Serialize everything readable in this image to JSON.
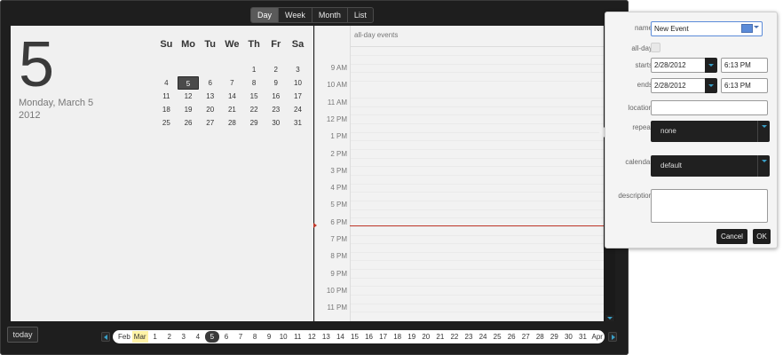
{
  "view_tabs": [
    "Day",
    "Week",
    "Month",
    "List"
  ],
  "active_view": "Day",
  "selected_day": {
    "day_number": "5",
    "day_name": "Monday, March 5",
    "year": "2012"
  },
  "mini_calendar": {
    "weekdays": [
      "Su",
      "Mo",
      "Tu",
      "We",
      "Th",
      "Fr",
      "Sa"
    ],
    "weeks": [
      [
        "",
        "",
        "",
        "",
        "1",
        "2",
        "3"
      ],
      [
        "4",
        "5",
        "6",
        "7",
        "8",
        "9",
        "10"
      ],
      [
        "11",
        "12",
        "13",
        "14",
        "15",
        "16",
        "17"
      ],
      [
        "18",
        "19",
        "20",
        "21",
        "22",
        "23",
        "24"
      ],
      [
        "25",
        "26",
        "27",
        "28",
        "29",
        "30",
        "31"
      ]
    ],
    "selected": "5"
  },
  "day_view": {
    "allday_label": "all-day events",
    "hours": [
      "9 AM",
      "10 AM",
      "11 AM",
      "12 PM",
      "1 PM",
      "2 PM",
      "3 PM",
      "4 PM",
      "5 PM",
      "6 PM",
      "7 PM",
      "8 PM",
      "9 PM",
      "10 PM",
      "11 PM"
    ]
  },
  "bottom_bar": {
    "today_label": "today",
    "prev_month": "Feb",
    "current_month": "Mar",
    "next_month": "Apr",
    "days": [
      "1",
      "2",
      "3",
      "4",
      "5",
      "6",
      "7",
      "8",
      "9",
      "10",
      "11",
      "12",
      "13",
      "14",
      "15",
      "16",
      "17",
      "18",
      "19",
      "20",
      "21",
      "22",
      "23",
      "24",
      "25",
      "26",
      "27",
      "28",
      "29",
      "30",
      "31"
    ],
    "selected_day": "5"
  },
  "event_form": {
    "name_label": "name",
    "name_value": "New Event",
    "allday_label": "all-day",
    "starts_label": "starts",
    "starts_date": "2/28/2012",
    "starts_time": "6:13 PM",
    "ends_label": "ends",
    "ends_date": "2/28/2012",
    "ends_time": "6:13 PM",
    "location_label": "location",
    "location_value": "",
    "repeat_label": "repeat",
    "repeat_value": "none",
    "calendar_label": "calendar",
    "calendar_value": "default",
    "description_label": "description",
    "description_value": "",
    "cancel_label": "Cancel",
    "ok_label": "OK"
  },
  "colors": {
    "event_color": "#5b8bd8",
    "now_line": "#c0392b",
    "accent_caret": "#3aa0c8"
  }
}
